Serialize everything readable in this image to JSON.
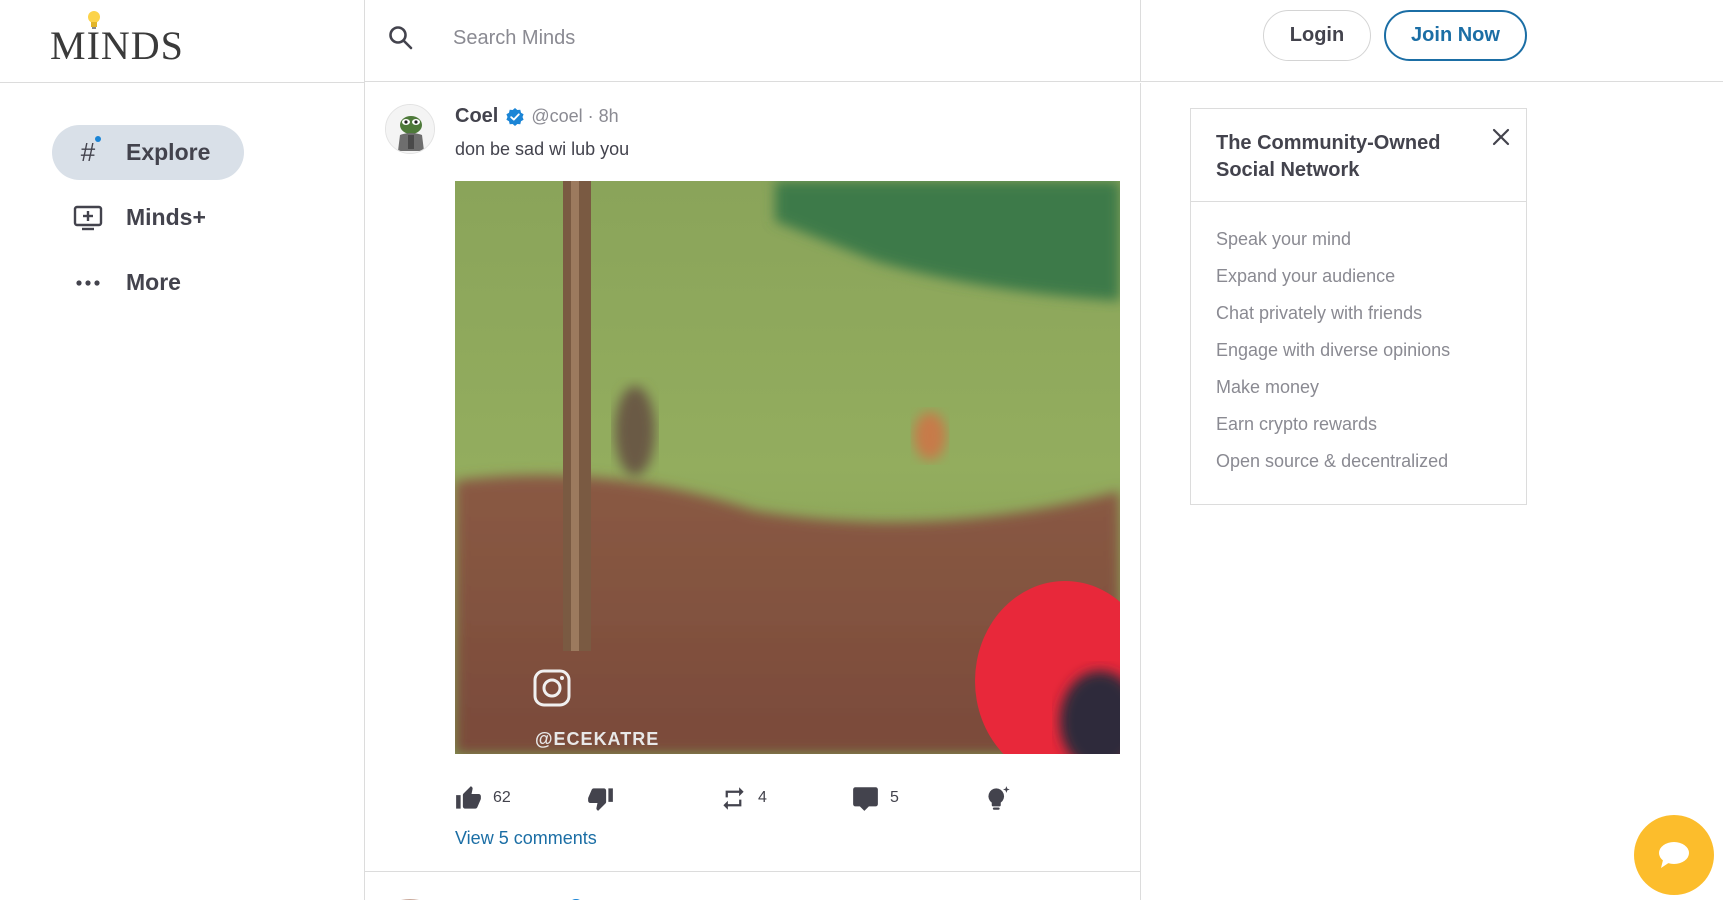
{
  "app": {
    "logo_text": "MINDS"
  },
  "sidebar": {
    "items": [
      {
        "label": "Explore",
        "icon": "hashtag-icon",
        "active": true
      },
      {
        "label": "Minds+",
        "icon": "minds-plus-icon",
        "active": false
      },
      {
        "label": "More",
        "icon": "more-dots-icon",
        "active": false
      }
    ]
  },
  "search": {
    "placeholder": "Search Minds",
    "value": ""
  },
  "header": {
    "login_label": "Login",
    "join_label": "Join Now"
  },
  "post": {
    "author": "Coel",
    "handle": "@coel · 8h",
    "text": "don be sad wi lub you",
    "media_watermark": "@ECEKATRE",
    "actions": {
      "upvotes": "62",
      "downvotes": "",
      "reminds": "4",
      "comments": "5"
    },
    "view_comments_label": "View 5 comments"
  },
  "promo": {
    "title": "The Community-Owned Social Network",
    "items": [
      "Speak your mind",
      "Expand your audience",
      "Chat privately with friends",
      "Engage with diverse opinions",
      "Make money",
      "Earn crypto rewards",
      "Open source & decentralized"
    ]
  },
  "colors": {
    "accent": "#1b6ea5",
    "verified": "#1b85d6",
    "active_nav_bg": "#d9e0e8",
    "chat_button": "#fcbd2c"
  }
}
